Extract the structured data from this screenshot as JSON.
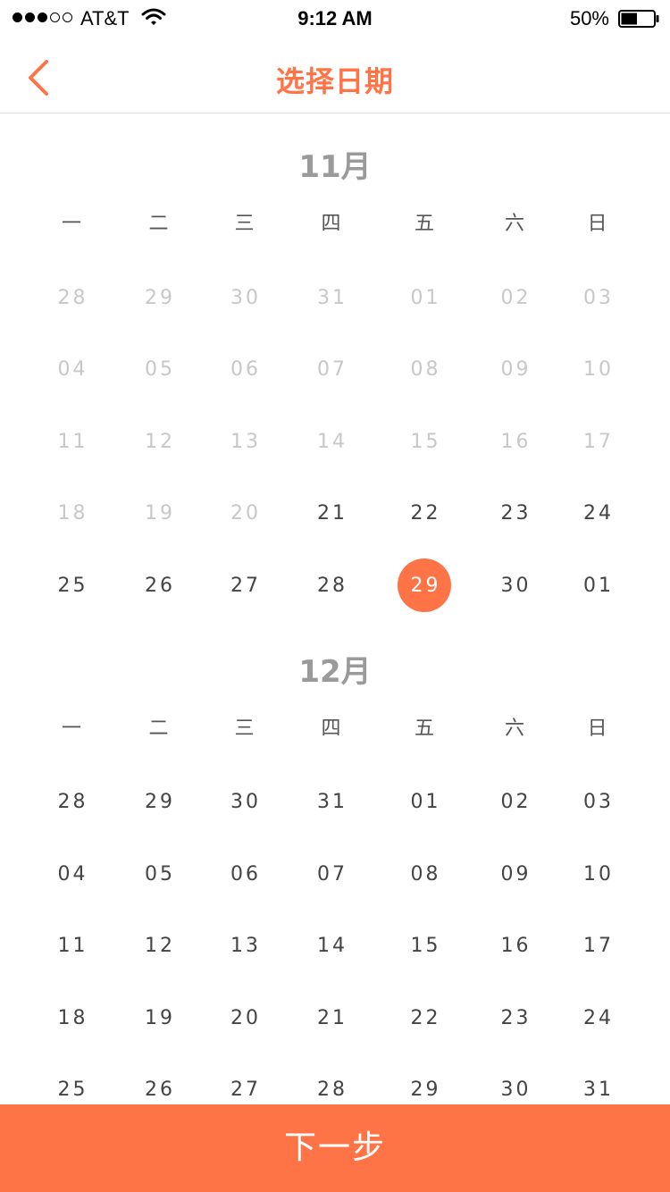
{
  "status_bar": {
    "carrier": "AT&T",
    "time": "9:12 AM",
    "battery_percent": "50%",
    "signal_bars_filled": 3,
    "signal_bars_total": 5,
    "battery_level": 0.5
  },
  "nav": {
    "back_icon": "chevron-left-icon",
    "title": "选择日期"
  },
  "theme": {
    "accent": "#ff7446",
    "disabled_text": "#c8c8c8",
    "normal_text": "#444444"
  },
  "weekdays": [
    "一",
    "二",
    "三",
    "四",
    "五",
    "六",
    "日"
  ],
  "months": [
    {
      "title": "11月",
      "weeks": [
        [
          {
            "d": "28",
            "s": "disabled"
          },
          {
            "d": "29",
            "s": "disabled"
          },
          {
            "d": "30",
            "s": "disabled"
          },
          {
            "d": "31",
            "s": "disabled"
          },
          {
            "d": "01",
            "s": "disabled"
          },
          {
            "d": "02",
            "s": "disabled"
          },
          {
            "d": "03",
            "s": "disabled"
          }
        ],
        [
          {
            "d": "04",
            "s": "disabled"
          },
          {
            "d": "05",
            "s": "disabled"
          },
          {
            "d": "06",
            "s": "disabled"
          },
          {
            "d": "07",
            "s": "disabled"
          },
          {
            "d": "08",
            "s": "disabled"
          },
          {
            "d": "09",
            "s": "disabled"
          },
          {
            "d": "10",
            "s": "disabled"
          }
        ],
        [
          {
            "d": "11",
            "s": "disabled"
          },
          {
            "d": "12",
            "s": "disabled"
          },
          {
            "d": "13",
            "s": "disabled"
          },
          {
            "d": "14",
            "s": "disabled"
          },
          {
            "d": "15",
            "s": "disabled"
          },
          {
            "d": "16",
            "s": "disabled"
          },
          {
            "d": "17",
            "s": "disabled"
          }
        ],
        [
          {
            "d": "18",
            "s": "disabled"
          },
          {
            "d": "19",
            "s": "disabled"
          },
          {
            "d": "20",
            "s": "disabled"
          },
          {
            "d": "21",
            "s": "normal"
          },
          {
            "d": "22",
            "s": "normal"
          },
          {
            "d": "23",
            "s": "normal"
          },
          {
            "d": "24",
            "s": "normal"
          }
        ],
        [
          {
            "d": "25",
            "s": "normal"
          },
          {
            "d": "26",
            "s": "normal"
          },
          {
            "d": "27",
            "s": "normal"
          },
          {
            "d": "28",
            "s": "normal"
          },
          {
            "d": "29",
            "s": "selected"
          },
          {
            "d": "30",
            "s": "normal"
          },
          {
            "d": "01",
            "s": "normal"
          }
        ]
      ]
    },
    {
      "title": "12月",
      "weeks": [
        [
          {
            "d": "28",
            "s": "normal"
          },
          {
            "d": "29",
            "s": "normal"
          },
          {
            "d": "30",
            "s": "normal"
          },
          {
            "d": "31",
            "s": "normal"
          },
          {
            "d": "01",
            "s": "normal"
          },
          {
            "d": "02",
            "s": "normal"
          },
          {
            "d": "03",
            "s": "normal"
          }
        ],
        [
          {
            "d": "04",
            "s": "normal"
          },
          {
            "d": "05",
            "s": "normal"
          },
          {
            "d": "06",
            "s": "normal"
          },
          {
            "d": "07",
            "s": "normal"
          },
          {
            "d": "08",
            "s": "normal"
          },
          {
            "d": "09",
            "s": "normal"
          },
          {
            "d": "10",
            "s": "normal"
          }
        ],
        [
          {
            "d": "11",
            "s": "normal"
          },
          {
            "d": "12",
            "s": "normal"
          },
          {
            "d": "13",
            "s": "normal"
          },
          {
            "d": "14",
            "s": "normal"
          },
          {
            "d": "15",
            "s": "normal"
          },
          {
            "d": "16",
            "s": "normal"
          },
          {
            "d": "17",
            "s": "normal"
          }
        ],
        [
          {
            "d": "18",
            "s": "normal"
          },
          {
            "d": "19",
            "s": "normal"
          },
          {
            "d": "20",
            "s": "normal"
          },
          {
            "d": "21",
            "s": "normal"
          },
          {
            "d": "22",
            "s": "normal"
          },
          {
            "d": "23",
            "s": "normal"
          },
          {
            "d": "24",
            "s": "normal"
          }
        ],
        [
          {
            "d": "25",
            "s": "normal"
          },
          {
            "d": "26",
            "s": "normal"
          },
          {
            "d": "27",
            "s": "normal"
          },
          {
            "d": "28",
            "s": "normal"
          },
          {
            "d": "29",
            "s": "normal"
          },
          {
            "d": "30",
            "s": "normal"
          },
          {
            "d": "31",
            "s": "normal"
          }
        ]
      ]
    }
  ],
  "footer": {
    "next_label": "下一步"
  }
}
